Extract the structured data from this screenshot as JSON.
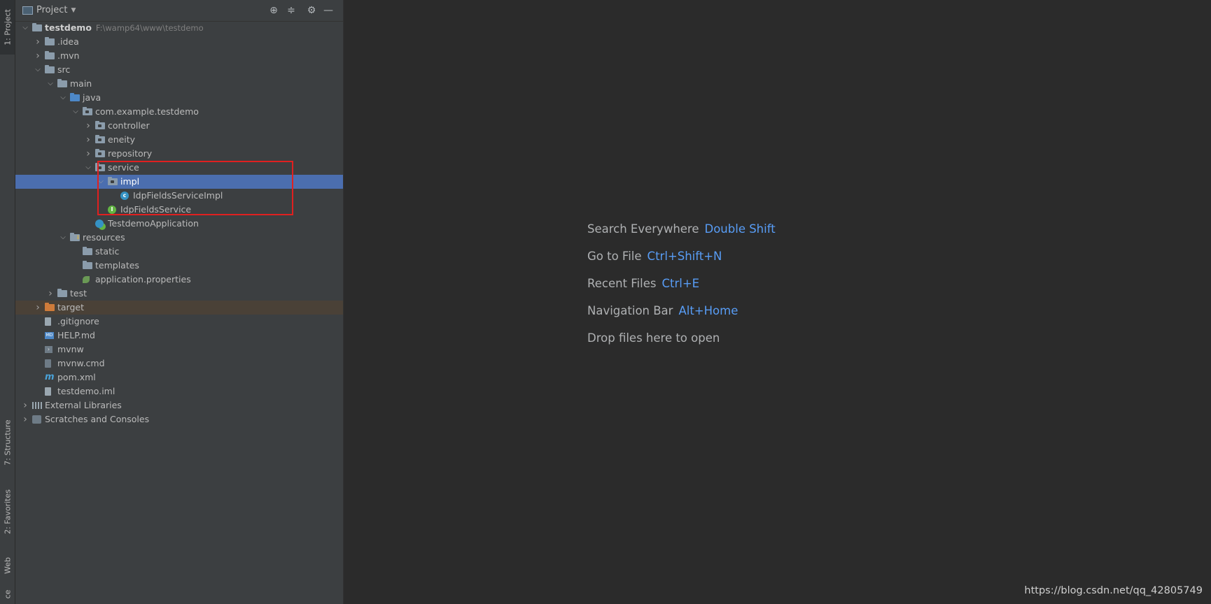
{
  "sidebar": {
    "tabs": [
      {
        "label": "1: Project"
      },
      {
        "label": "7: Structure"
      },
      {
        "label": "2: Favorites"
      },
      {
        "label": "Web"
      },
      {
        "label": "ce"
      }
    ]
  },
  "panel": {
    "title": "Project"
  },
  "tree": [
    {
      "label": "testdemo",
      "hint": "F:\\wamp64\\www\\testdemo",
      "icon": "folder-icon"
    },
    {
      "label": ".idea",
      "icon": "folder-icon"
    },
    {
      "label": ".mvn",
      "icon": "folder-icon"
    },
    {
      "label": "src",
      "icon": "folder-icon"
    },
    {
      "label": "main",
      "icon": "folder-icon"
    },
    {
      "label": "java",
      "icon": "source-folder-icon"
    },
    {
      "label": "com.example.testdemo",
      "icon": "package-icon"
    },
    {
      "label": "controller",
      "icon": "package-icon"
    },
    {
      "label": "eneity",
      "icon": "package-icon"
    },
    {
      "label": "repository",
      "icon": "package-icon"
    },
    {
      "label": "service",
      "icon": "package-icon"
    },
    {
      "label": "impl",
      "icon": "package-icon"
    },
    {
      "label": "IdpFieldsServiceImpl",
      "icon": "class-icon"
    },
    {
      "label": "IdpFieldsService",
      "icon": "interface-icon"
    },
    {
      "label": "TestdemoApplication",
      "icon": "spring-app-icon"
    },
    {
      "label": "resources",
      "icon": "resources-folder-icon"
    },
    {
      "label": "static",
      "icon": "folder-icon"
    },
    {
      "label": "templates",
      "icon": "folder-icon"
    },
    {
      "label": "application.properties",
      "icon": "properties-icon"
    },
    {
      "label": "test",
      "icon": "folder-icon"
    },
    {
      "label": "target",
      "icon": "excluded-folder-icon"
    },
    {
      "label": ".gitignore",
      "icon": "file-icon"
    },
    {
      "label": "HELP.md",
      "icon": "markdown-icon"
    },
    {
      "label": "mvnw",
      "icon": "script-icon"
    },
    {
      "label": "mvnw.cmd",
      "icon": "file-icon"
    },
    {
      "label": "pom.xml",
      "icon": "maven-icon"
    },
    {
      "label": "testdemo.iml",
      "icon": "file-icon"
    },
    {
      "label": "External Libraries",
      "icon": "libraries-icon"
    },
    {
      "label": "Scratches and Consoles",
      "icon": "scratches-icon"
    }
  ],
  "editor": {
    "hints": [
      {
        "text": "Search Everywhere",
        "key": "Double Shift"
      },
      {
        "text": "Go to File",
        "key": "Ctrl+Shift+N"
      },
      {
        "text": "Recent Files",
        "key": "Ctrl+E"
      },
      {
        "text": "Navigation Bar",
        "key": "Alt+Home"
      },
      {
        "text": "Drop files here to open",
        "key": ""
      }
    ]
  },
  "watermark": "https://blog.csdn.net/qq_42805749",
  "colors": {
    "accent": "#589df6",
    "selection": "#4b6eaf",
    "highlight": "#e02020"
  }
}
